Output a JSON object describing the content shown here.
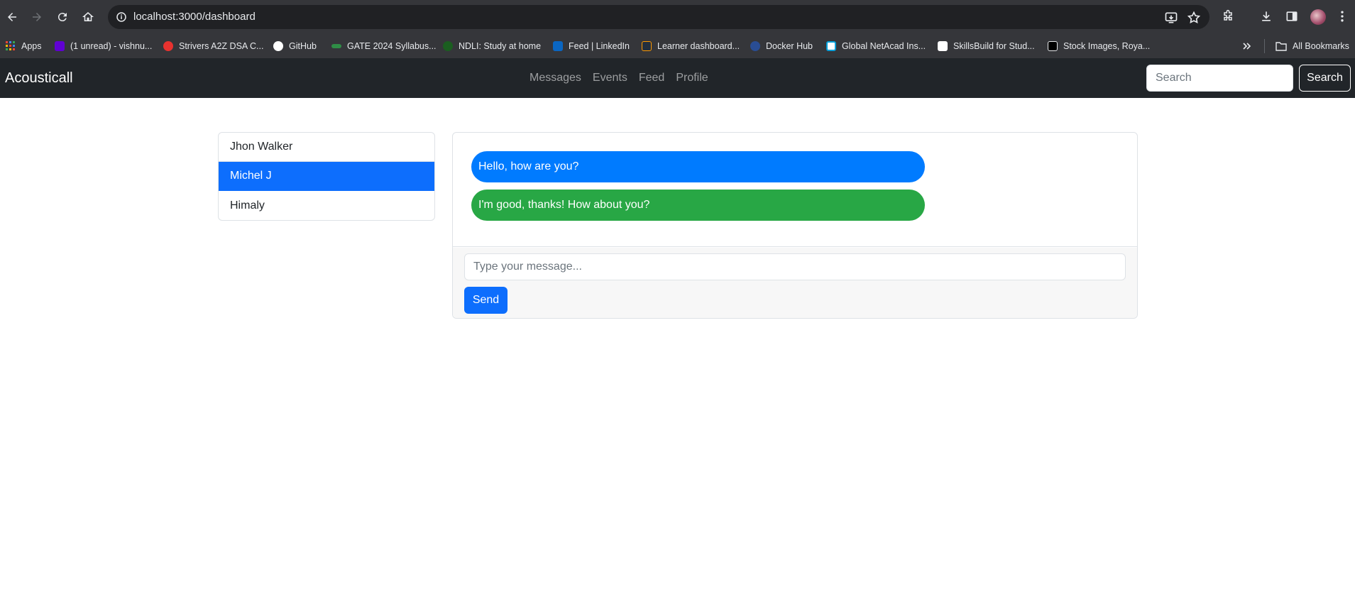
{
  "browser": {
    "url": "localhost:3000/dashboard",
    "bookmarks": [
      {
        "label": "Apps",
        "icon": "apps-grid-icon",
        "color": "#e8eaed"
      },
      {
        "label": "(1 unread) - vishnu...",
        "icon": "yahoo-mail-icon",
        "color": "#6001d2"
      },
      {
        "label": "Strivers A2Z DSA C...",
        "icon": "tuf-icon",
        "color": "#e8322f"
      },
      {
        "label": "GitHub",
        "icon": "github-icon",
        "color": "#ffffff"
      },
      {
        "label": "GATE 2024 Syllabus...",
        "icon": "gfg-icon",
        "color": "#2f8d46"
      },
      {
        "label": "NDLI: Study at home",
        "icon": "ndli-icon",
        "color": "#1b5e20"
      },
      {
        "label": "Feed | LinkedIn",
        "icon": "linkedin-icon",
        "color": "#0a66c2"
      },
      {
        "label": "Learner dashboard...",
        "icon": "aws-icon",
        "color": "#232f3e"
      },
      {
        "label": "Docker Hub",
        "icon": "docker-icon",
        "color": "#1d63ed"
      },
      {
        "label": "Global NetAcad Ins...",
        "icon": "netacad-icon",
        "color": "#049fd9"
      },
      {
        "label": "SkillsBuild for Stud...",
        "icon": "skillsbuild-icon",
        "color": "#ffffff"
      },
      {
        "label": "Stock Images, Roya...",
        "icon": "istock-icon",
        "color": "#000000"
      }
    ],
    "all_bookmarks_label": "All Bookmarks"
  },
  "navbar": {
    "brand": "Acousticall",
    "links": [
      "Messages",
      "Events",
      "Feed",
      "Profile"
    ],
    "search_placeholder": "Search",
    "search_button": "Search"
  },
  "contacts": [
    {
      "name": "Jhon Walker",
      "active": false
    },
    {
      "name": "Michel J",
      "active": true
    },
    {
      "name": "Himaly",
      "active": false
    }
  ],
  "chat": {
    "messages": [
      {
        "text": "Hello, how are you?",
        "type": "received",
        "color": "#007bff"
      },
      {
        "text": "I'm good, thanks! How about you?",
        "type": "sent",
        "color": "#28a745"
      }
    ],
    "input_placeholder": "Type your message...",
    "send_label": "Send"
  },
  "colors": {
    "primary": "#0d6efd",
    "navbar_bg": "#212529",
    "browser_bg": "#35363a"
  }
}
